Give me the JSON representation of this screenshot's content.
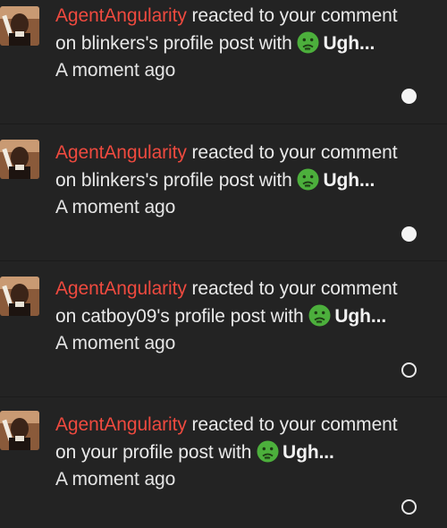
{
  "notifications": [
    {
      "username": "AgentAngularity",
      "action": " reacted to your comment on blinkers's profile post with",
      "reaction_label": "Ugh...",
      "timestamp": "A moment ago",
      "unread": true
    },
    {
      "username": "AgentAngularity",
      "action": " reacted to your comment on blinkers's profile post with",
      "reaction_label": "Ugh...",
      "timestamp": "A moment ago",
      "unread": true
    },
    {
      "username": "AgentAngularity",
      "action": " reacted to your comment on catboy09's profile post with",
      "reaction_label": "Ugh...",
      "timestamp": "A moment ago",
      "unread": false
    },
    {
      "username": "AgentAngularity",
      "action": " reacted to your comment on your profile post with",
      "reaction_label": "Ugh...",
      "timestamp": "A moment ago",
      "unread": false
    }
  ],
  "colors": {
    "background": "#232323",
    "username": "#ef4a3f",
    "reaction_face": "#4caf3c"
  },
  "icons": {
    "avatar": "user-avatar",
    "reaction": "sick-face-emoji",
    "unread": "filled-dot",
    "read": "hollow-dot"
  }
}
